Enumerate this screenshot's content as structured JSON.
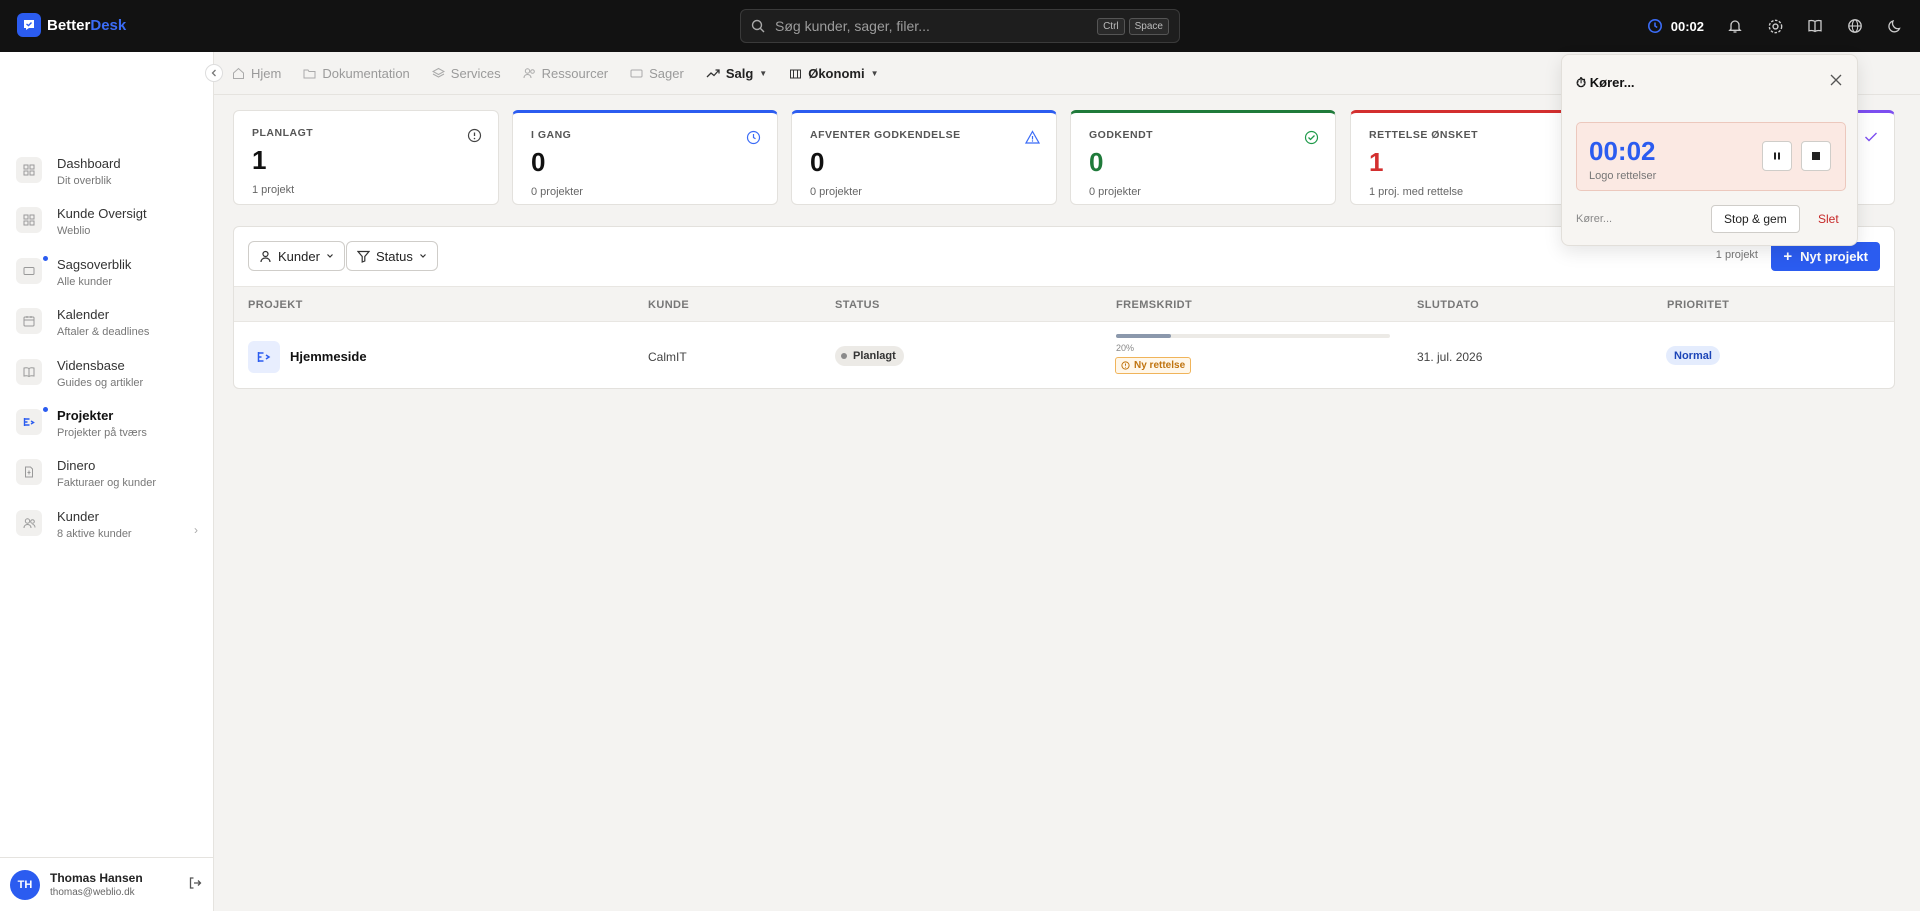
{
  "app": {
    "brand_part1": "Better",
    "brand_part2": "Desk",
    "accent": "#2b5cf0"
  },
  "search": {
    "placeholder": "Søg kunder, sager, filer...",
    "kbd1": "Ctrl",
    "kbd2": "Space"
  },
  "topbar": {
    "timer": "00:02",
    "icons": [
      "clock-icon",
      "bell-icon",
      "gear-icon",
      "book-icon",
      "globe-icon",
      "moon-icon"
    ]
  },
  "sidebar": {
    "items": [
      {
        "label": "Dashboard",
        "sub": "Dit overblik",
        "icon": "grid-icon"
      },
      {
        "label": "Kunde Oversigt",
        "sub": "Weblio",
        "icon": "grid-icon"
      },
      {
        "label": "Sagsoverblik",
        "sub": "Alle kunder",
        "icon": "ticket-icon"
      },
      {
        "label": "Kalender",
        "sub": "Aftaler & deadlines",
        "icon": "calendar-icon"
      },
      {
        "label": "Vidensbase",
        "sub": "Guides og artikler",
        "icon": "book-icon"
      },
      {
        "label": "Projekter",
        "sub": "Projekter på tværs",
        "icon": "project-icon"
      },
      {
        "label": "Dinero",
        "sub": "Fakturaer og kunder",
        "icon": "invoice-icon"
      },
      {
        "label": "Kunder",
        "sub": "8 aktive kunder",
        "icon": "users-icon"
      }
    ],
    "user": {
      "initials": "TH",
      "name": "Thomas Hansen",
      "email": "thomas@weblio.dk"
    }
  },
  "tabs": [
    "Hjem",
    "Dokumentation",
    "Services",
    "Ressourcer",
    "Sager",
    "Salg",
    "Økonomi"
  ],
  "stats": [
    {
      "title": "PLANLAGT",
      "value": "1",
      "sub": "1 projekt",
      "color": "#111111"
    },
    {
      "title": "I GANG",
      "value": "0",
      "sub": "0 projekter",
      "color": "#111111"
    },
    {
      "title": "AFVENTER GODKENDELSE",
      "value": "0",
      "sub": "0 projekter",
      "color": "#111111"
    },
    {
      "title": "GODKENDT",
      "value": "0",
      "sub": "0 projekter",
      "color": "#1f7a3a"
    },
    {
      "title": "RETTELSE ØNSKET",
      "value": "1",
      "sub": "1 proj. med rettelse",
      "color": "#d32f2f"
    }
  ],
  "filters": {
    "customers": "Kunder",
    "status": "Status"
  },
  "list": {
    "count": "1 projekt",
    "new_button": "Nyt projekt",
    "headers": [
      "PROJEKT",
      "KUNDE",
      "STATUS",
      "FREMSKRIDT",
      "SLUTDATO",
      "PRIORITET"
    ],
    "rows": [
      {
        "name": "Hjemmeside",
        "customer": "CalmIT",
        "status": "Planlagt",
        "progress": 20,
        "progress_label": "20%",
        "revision": "Ny rettelse",
        "end_date": "31. jul. 2026",
        "priority": "Normal"
      }
    ]
  },
  "timer_popover": {
    "title": "⏱ Kører...",
    "time": "00:02",
    "task": "Logo rettelser",
    "status": "Kører...",
    "save": "Stop & gem",
    "delete": "Slet"
  }
}
